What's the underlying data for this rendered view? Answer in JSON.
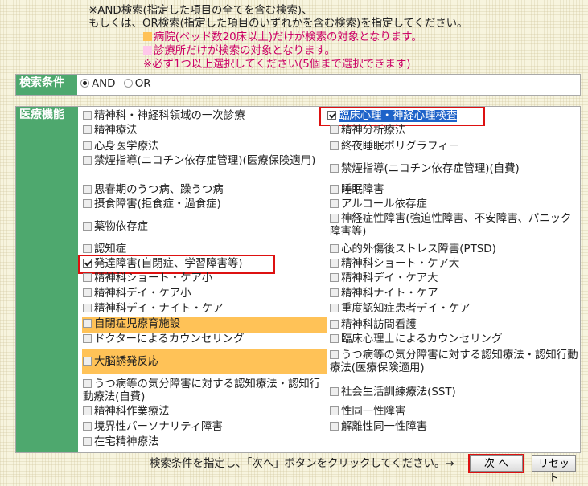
{
  "notes": {
    "line1": "※AND検索(指定した項目の全てを含む検索)、",
    "line2": "もしくは、OR検索(指定した項目のいずれかを含む検索)を指定してください。",
    "line3": "病院(ベッド数20床以上)だけが検索の対象となります。",
    "line4": "診療所だけが検索の対象となります。",
    "line5": "※必ず1つ以上選択してください(5個まで選択できます)"
  },
  "colors": {
    "green": "#4ea86e",
    "orange": "#ffc257",
    "pink": "#ffc8ea",
    "red": "#dd1111"
  },
  "search_condition": {
    "header": "検索条件",
    "and_label": "AND",
    "or_label": "OR",
    "selected": "AND"
  },
  "medical": {
    "header": "医療機能",
    "items": [
      {
        "label": "精神科・神経科領域の一次診療",
        "checked": false
      },
      {
        "label": "臨床心理・神経心理検査",
        "checked": true
      },
      {
        "label": "精神療法",
        "checked": false
      },
      {
        "label": "精神分析療法",
        "checked": false
      },
      {
        "label": "心身医学療法",
        "checked": false
      },
      {
        "label": "終夜睡眠ポリグラフィー",
        "checked": false
      },
      {
        "label": "禁煙指導(ニコチン依存症管理)(医療保険適用)",
        "checked": false
      },
      {
        "label": "禁煙指導(ニコチン依存症管理)(自費)",
        "checked": false
      },
      {
        "label": "思春期のうつ病、躁うつ病",
        "checked": false
      },
      {
        "label": "睡眠障害",
        "checked": false
      },
      {
        "label": "摂食障害(拒食症・過食症)",
        "checked": false
      },
      {
        "label": "アルコール依存症",
        "checked": false
      },
      {
        "label": "薬物依存症",
        "checked": false
      },
      {
        "label": "神経症性障害(強迫性障害、不安障害、パニック障害等)",
        "checked": false
      },
      {
        "label": "認知症",
        "checked": false
      },
      {
        "label": "心的外傷後ストレス障害(PTSD)",
        "checked": false
      },
      {
        "label": "発達障害(自閉症、学習障害等)",
        "checked": true
      },
      {
        "label": "精神科ショート・ケア大",
        "checked": false
      },
      {
        "label": "精神科ショート・ケア小",
        "checked": false
      },
      {
        "label": "精神科デイ・ケア大",
        "checked": false
      },
      {
        "label": "精神科デイ・ケア小",
        "checked": false
      },
      {
        "label": "精神科ナイト・ケア",
        "checked": false
      },
      {
        "label": "精神科デイ・ナイト・ケア",
        "checked": false
      },
      {
        "label": "重度認知症患者デイ・ケア",
        "checked": false
      },
      {
        "label": "自閉症児療育施設",
        "checked": false
      },
      {
        "label": "精神科訪問看護",
        "checked": false
      },
      {
        "label": "ドクターによるカウンセリング",
        "checked": false
      },
      {
        "label": "臨床心理士によるカウンセリング",
        "checked": false
      },
      {
        "label": "大脳誘発反応",
        "checked": false
      },
      {
        "label": "うつ病等の気分障害に対する認知療法・認知行動療法(医療保険適用)",
        "checked": false
      },
      {
        "label": "うつ病等の気分障害に対する認知療法・認知行動療法(自費)",
        "checked": false
      },
      {
        "label": "社会生活訓練療法(SST)",
        "checked": false
      },
      {
        "label": "精神科作業療法",
        "checked": false
      },
      {
        "label": "性同一性障害",
        "checked": false
      },
      {
        "label": "境界性パーソナリティ障害",
        "checked": false
      },
      {
        "label": "解離性同一性障害",
        "checked": false
      },
      {
        "label": "在宅精神療法",
        "checked": false
      }
    ]
  },
  "footer": {
    "instruction": "検索条件を指定し、「次へ」ボタンをクリックしてください。→",
    "next_label": "次 へ",
    "reset_label": "リセット"
  }
}
